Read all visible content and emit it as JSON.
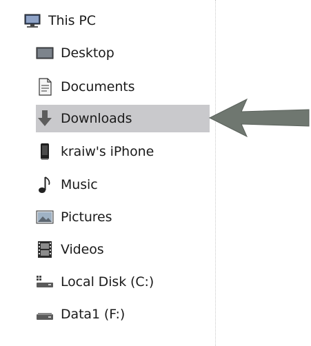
{
  "nav": {
    "root": {
      "label": "This PC",
      "icon": "computer-icon"
    },
    "items": [
      {
        "label": "Desktop",
        "icon": "desktop-icon"
      },
      {
        "label": "Documents",
        "icon": "document-icon"
      },
      {
        "label": "Downloads",
        "icon": "download-arrow-icon",
        "selected": true
      },
      {
        "label": "kraiw's iPhone",
        "icon": "phone-icon"
      },
      {
        "label": "Music",
        "icon": "music-note-icon"
      },
      {
        "label": "Pictures",
        "icon": "picture-icon"
      },
      {
        "label": "Videos",
        "icon": "film-icon"
      },
      {
        "label": "Local Disk (C:)",
        "icon": "system-drive-icon"
      },
      {
        "label": "Data1 (F:)",
        "icon": "drive-icon"
      }
    ]
  },
  "colors": {
    "selection": "#c9c9cc",
    "arrow": "#6f7770"
  }
}
